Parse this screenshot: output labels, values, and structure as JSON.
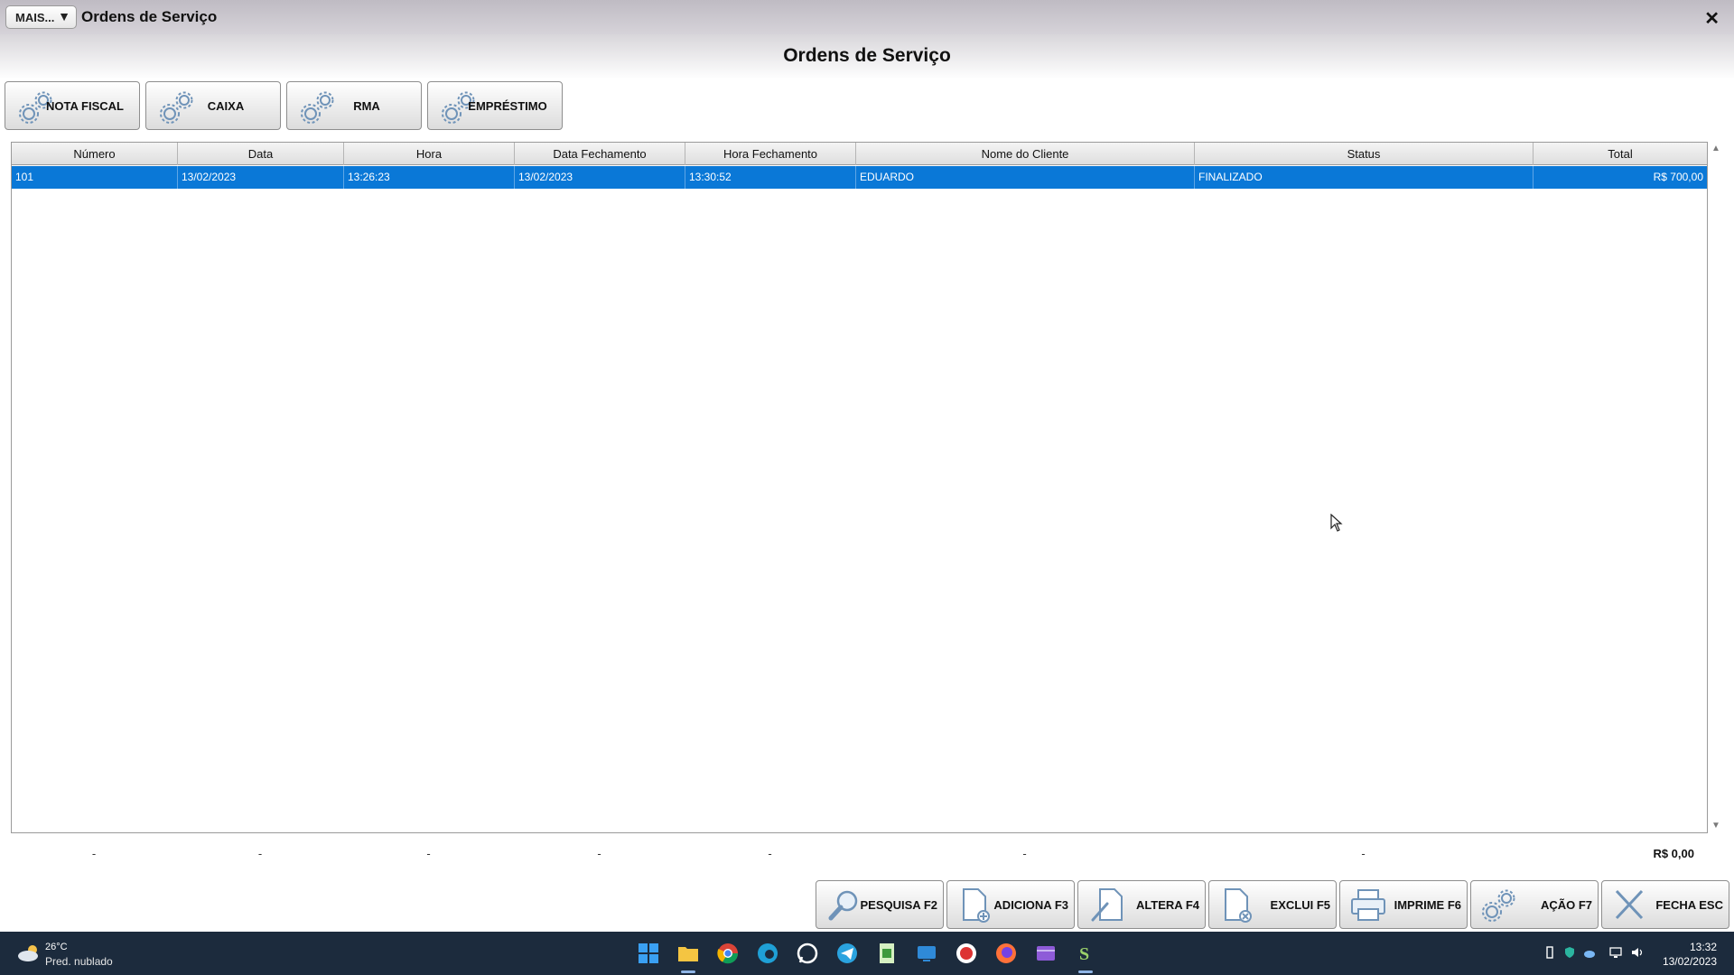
{
  "window": {
    "more_label": "MAIS...",
    "more_arrow": "▼",
    "title": "Ordens de Serviço",
    "close_glyph": "✕"
  },
  "page_title": "Ordens de Serviço",
  "top_buttons": [
    {
      "label": "NOTA FISCAL",
      "icon": "gear-icon"
    },
    {
      "label": "CAIXA",
      "icon": "gear-icon"
    },
    {
      "label": "RMA",
      "icon": "gear-icon"
    },
    {
      "label": "EMPRÉSTIMO",
      "icon": "gear-icon"
    }
  ],
  "grid": {
    "columns": [
      "Número",
      "Data",
      "Hora",
      "Data Fechamento",
      "Hora Fechamento",
      "Nome do Cliente",
      "Status",
      "Total"
    ],
    "rows": [
      [
        "101",
        "13/02/2023",
        "13:26:23",
        "13/02/2023",
        "13:30:52",
        "EDUARDO",
        "FINALIZADO",
        "R$ 700,00"
      ]
    ],
    "selected_row": 0
  },
  "footer": {
    "placeholders": [
      "-",
      "-",
      "-",
      "-",
      "-",
      "-",
      "-"
    ],
    "total": "R$ 0,00"
  },
  "bottom_buttons": [
    {
      "label": "PESQUISA F2",
      "icon": "magnifier-icon"
    },
    {
      "label": "ADICIONA F3",
      "icon": "add-document-icon"
    },
    {
      "label": "ALTERA F4",
      "icon": "edit-document-icon"
    },
    {
      "label": "EXCLUI F5",
      "icon": "delete-document-icon"
    },
    {
      "label": "IMPRIME F6",
      "icon": "printer-icon"
    },
    {
      "label": "AÇÃO F7",
      "icon": "gear-icon"
    },
    {
      "label": "FECHA ESC",
      "icon": "close-icon"
    }
  ],
  "taskbar": {
    "weather_temp": "26°C",
    "weather_desc": "Pred. nublado",
    "time": "13:32",
    "date": "13/02/2023"
  },
  "colors": {
    "selection": "#0a78d7",
    "taskbar": "#1c2b3d"
  }
}
